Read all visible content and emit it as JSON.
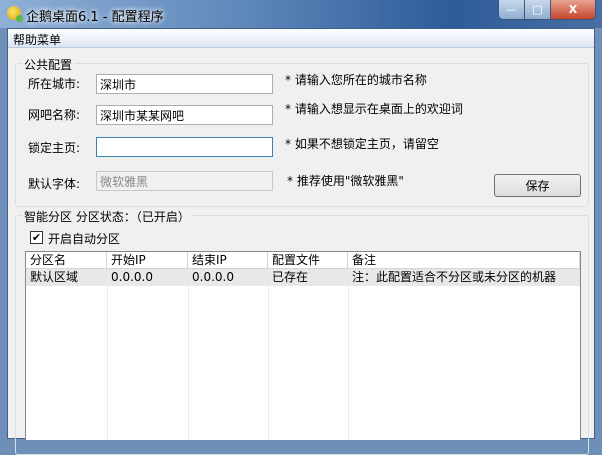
{
  "window": {
    "title": "企鹅桌面6.1 - 配置程序",
    "minimize": "—",
    "maximize": "□",
    "close": "X"
  },
  "menu": {
    "help": "帮助菜单"
  },
  "public": {
    "title": "公共配置",
    "city_label": "所在城市:",
    "city_value": "深圳市",
    "city_hint": "* 请输入您所在的城市名称",
    "netbar_label": "网吧名称:",
    "netbar_value": "深圳市某某网吧",
    "netbar_hint": "* 请输入想显示在桌面上的欢迎词",
    "home_label": "锁定主页:",
    "home_value": "",
    "home_hint": "* 如果不想锁定主页，请留空",
    "font_label": "默认字体:",
    "font_value": "微软雅黑",
    "font_hint": "* 推荐使用\"微软雅黑\"",
    "save": "保存"
  },
  "partition": {
    "title": "智能分区 分区状态：（已开启）",
    "auto_label": "开启自动分区",
    "auto_checked": true,
    "columns": [
      "分区名",
      "开始IP",
      "结束IP",
      "配置文件",
      "备注"
    ],
    "rows": [
      [
        "默认区域",
        "0.0.0.0",
        "0.0.0.0",
        "已存在",
        "注：此配置适合不分区或未分区的机器"
      ]
    ]
  }
}
